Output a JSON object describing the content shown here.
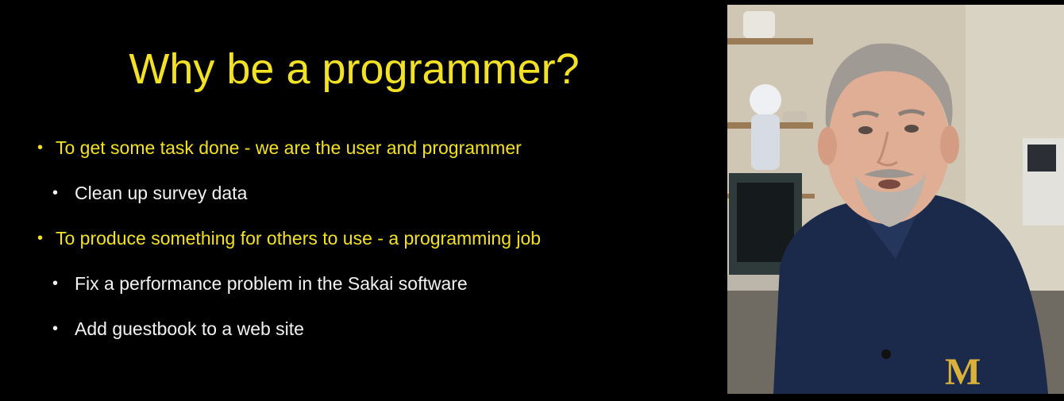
{
  "slide": {
    "title": "Why be a programmer?",
    "bullets": [
      {
        "level": 1,
        "text": "To get some task done - we are the user and programmer"
      },
      {
        "level": 2,
        "text": "Clean up survey data"
      },
      {
        "level": 1,
        "text": "To produce something for others to use - a programming job"
      },
      {
        "level": 2,
        "text": "Fix a performance problem in the Sakai software"
      },
      {
        "level": 2,
        "text": "Add  guestbook to a web site"
      }
    ],
    "bullet_glyph": "•",
    "colors": {
      "background": "#000000",
      "title": "#f2e125",
      "level1_text": "#f2e125",
      "level2_text": "#f2f2f2"
    }
  },
  "video": {
    "shirt_logo": "M",
    "colors": {
      "wall": "#cfc6b4",
      "shirt": "#1b2a4a",
      "logo": "#d9b13b"
    }
  }
}
